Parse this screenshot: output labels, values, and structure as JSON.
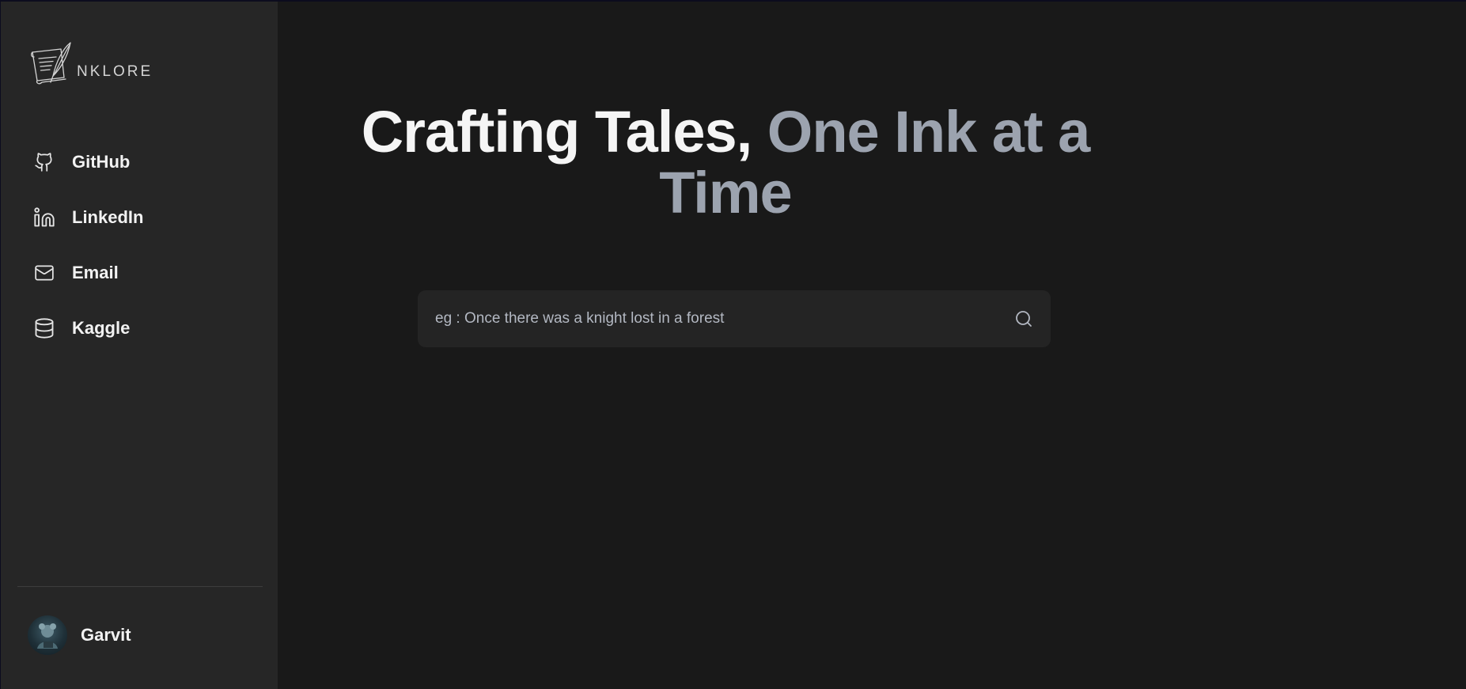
{
  "brand": {
    "logo_text": "NKLORE",
    "logo_icon": "quill-scroll-icon"
  },
  "sidebar": {
    "items": [
      {
        "label": "GitHub",
        "icon": "github-icon"
      },
      {
        "label": "LinkedIn",
        "icon": "linkedin-icon"
      },
      {
        "label": "Email",
        "icon": "mail-icon"
      },
      {
        "label": "Kaggle",
        "icon": "database-icon"
      }
    ],
    "user": {
      "name": "Garvit",
      "icon": "avatar"
    }
  },
  "hero": {
    "title_part1": "Crafting Tales,",
    "title_part2": "One Ink at a Time"
  },
  "search": {
    "placeholder": "eg : Once there was a knight lost in a forest",
    "value": "",
    "icon": "search-icon"
  },
  "colors": {
    "page_bg": "#191919",
    "sidebar_bg": "#262626",
    "heading_white": "#f5f5f5",
    "heading_gray": "#9ca3af",
    "search_bg": "#242424"
  }
}
